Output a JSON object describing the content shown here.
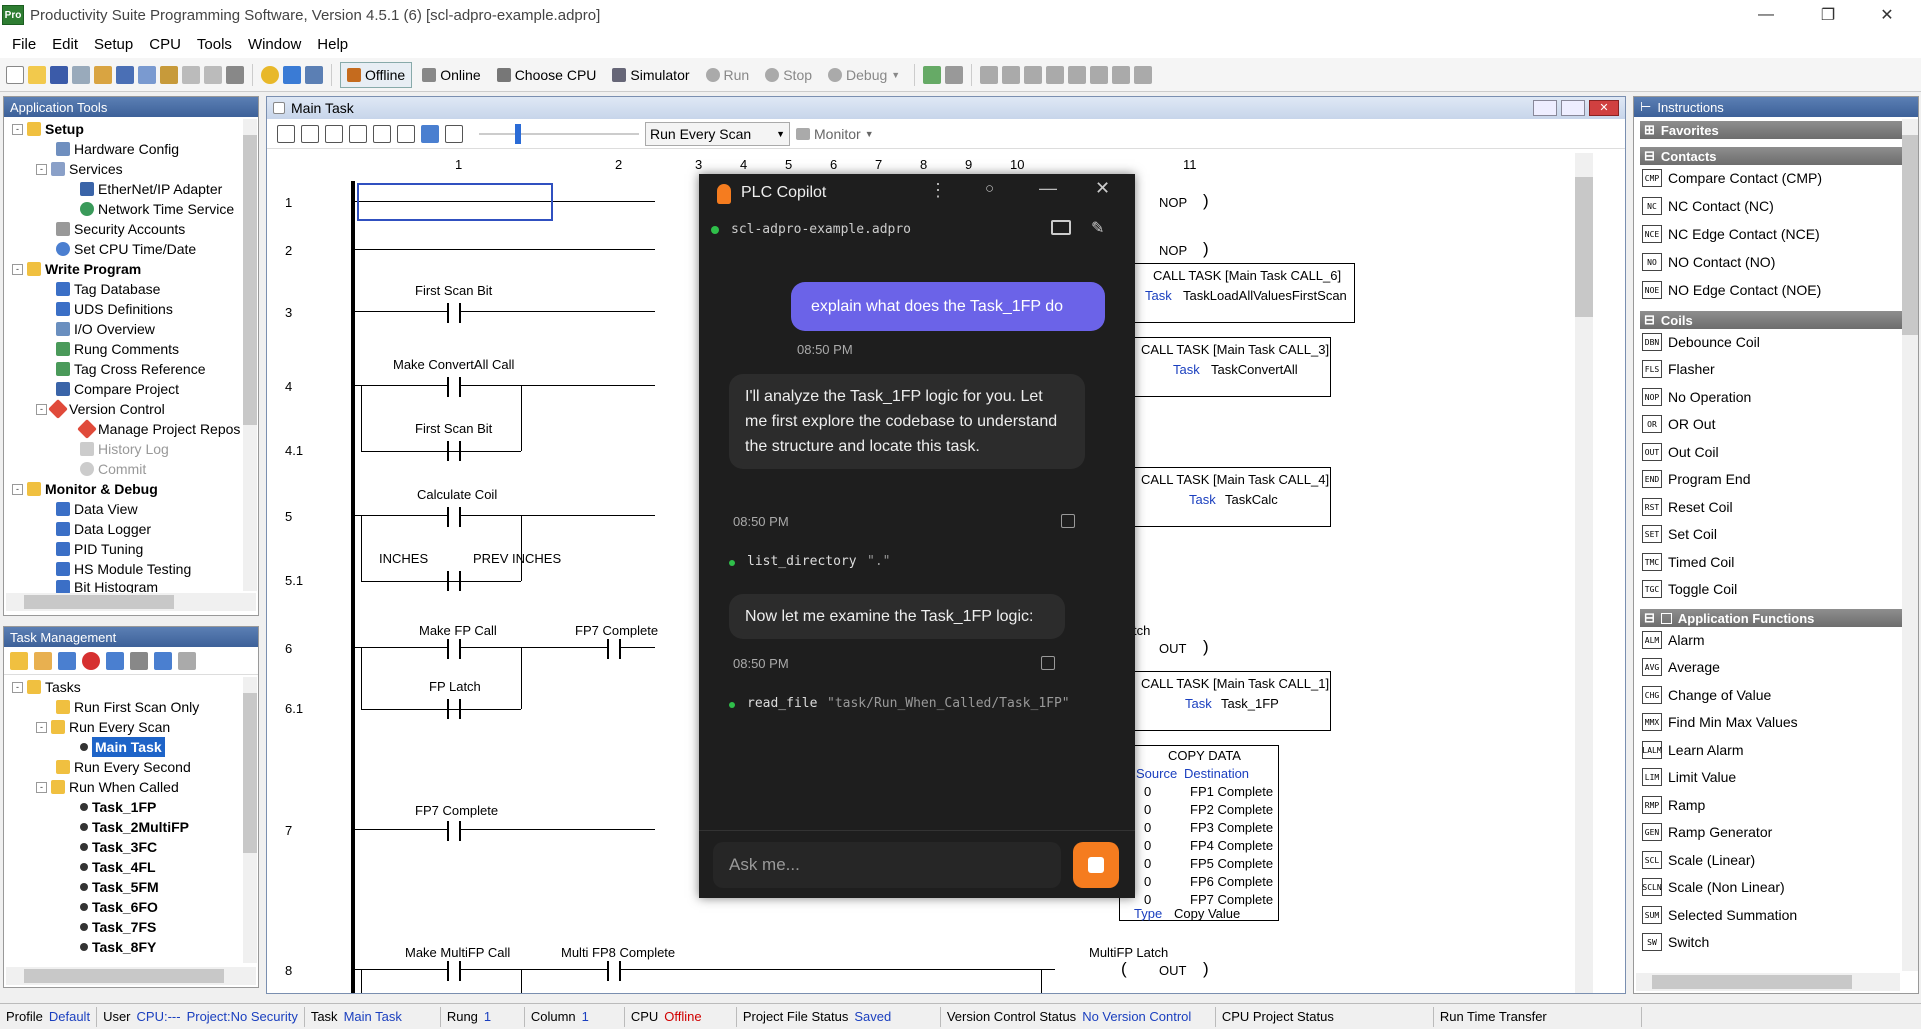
{
  "window": {
    "title": "Productivity Suite Programming Software, Version 4.5.1 (6)   [scl-adpro-example.adpro]",
    "logo": "Pro"
  },
  "menu": [
    "File",
    "Edit",
    "Setup",
    "CPU",
    "Tools",
    "Window",
    "Help"
  ],
  "toolbar": {
    "offline": "Offline",
    "online": "Online",
    "choose_cpu": "Choose CPU",
    "simulator": "Simulator",
    "run": "Run",
    "stop": "Stop",
    "debug": "Debug"
  },
  "app_tools": {
    "title": "Application Tools",
    "items": [
      {
        "label": "Setup"
      },
      {
        "label": "Hardware Config"
      },
      {
        "label": "Services"
      },
      {
        "label": "EtherNet/IP Adapter"
      },
      {
        "label": "Network Time Service"
      },
      {
        "label": "Security Accounts"
      },
      {
        "label": "Set CPU Time/Date"
      },
      {
        "label": "Write Program"
      },
      {
        "label": "Tag Database"
      },
      {
        "label": "UDS Definitions"
      },
      {
        "label": "I/O Overview"
      },
      {
        "label": "Rung Comments"
      },
      {
        "label": "Tag Cross Reference"
      },
      {
        "label": "Compare Project"
      },
      {
        "label": "Version Control"
      },
      {
        "label": "Manage Project Repos"
      },
      {
        "label": "History Log"
      },
      {
        "label": "Commit"
      },
      {
        "label": "Monitor & Debug"
      },
      {
        "label": "Data View"
      },
      {
        "label": "Data Logger"
      },
      {
        "label": "PID Tuning"
      },
      {
        "label": "HS Module Testing"
      },
      {
        "label": "Bit Histogram"
      }
    ]
  },
  "task_mgmt": {
    "title": "Task Management",
    "items": [
      {
        "label": "Tasks"
      },
      {
        "label": "Run First Scan Only"
      },
      {
        "label": "Run Every Scan"
      },
      {
        "label": "Main Task"
      },
      {
        "label": "Run Every Second"
      },
      {
        "label": "Run When Called"
      },
      {
        "label": "Task_1FP"
      },
      {
        "label": "Task_2MultiFP"
      },
      {
        "label": "Task_3FC"
      },
      {
        "label": "Task_4FL"
      },
      {
        "label": "Task_5FM"
      },
      {
        "label": "Task_6FO"
      },
      {
        "label": "Task_7FS"
      },
      {
        "label": "Task_8FY"
      }
    ]
  },
  "editor": {
    "title": "Main Task",
    "scan_select": "Run Every Scan",
    "monitor": "Monitor",
    "columns": [
      "1",
      "2",
      "3",
      "4",
      "5",
      "6",
      "7",
      "8",
      "9",
      "10",
      "11"
    ],
    "rungs": [
      "1",
      "2",
      "3",
      "4",
      "4.1",
      "5",
      "5.1",
      "6",
      "6.1",
      "7",
      "8"
    ],
    "labels": {
      "first_scan_bit": "First Scan Bit",
      "make_convertall": "Make ConvertAll Call",
      "first_scan_bit2": "First Scan Bit",
      "calculate_coil": "Calculate Coil",
      "inches": "INCHES",
      "prev_inches": "PREV INCHES",
      "make_fp_call": "Make FP Call",
      "fp7_complete": "FP7 Complete",
      "fp_latch": "FP Latch",
      "fp7_complete2": "FP7 Complete",
      "make_multifp": "Make MultiFP Call",
      "multi_fp8": "Multi FP8 Complete",
      "multifp_latch": "MultiFP Latch",
      "nop1": "NOP",
      "nop2": "NOP",
      "tch": "tch",
      "out6": "OUT",
      "out8": "OUT",
      "paren": ")",
      "lparen": "("
    },
    "calls": [
      {
        "header": "CALL TASK [Main Task CALL_6]",
        "key": "Task",
        "value": "TaskLoadAllValuesFirstScan"
      },
      {
        "header": "CALL TASK [Main Task CALL_3]",
        "key": "Task",
        "value": "TaskConvertAll"
      },
      {
        "header": "CALL TASK [Main Task CALL_4]",
        "key": "Task",
        "value": "TaskCalc"
      },
      {
        "header": "CALL TASK [Main Task CALL_1]",
        "key": "Task",
        "value": "Task_1FP"
      }
    ],
    "copy_data": {
      "header": "COPY DATA",
      "source_lbl": "Source",
      "dest_lbl": "Destination",
      "rows": [
        {
          "s": "0",
          "d": "FP1 Complete"
        },
        {
          "s": "0",
          "d": "FP2 Complete"
        },
        {
          "s": "0",
          "d": "FP3 Complete"
        },
        {
          "s": "0",
          "d": "FP4 Complete"
        },
        {
          "s": "0",
          "d": "FP5 Complete"
        },
        {
          "s": "0",
          "d": "FP6 Complete"
        },
        {
          "s": "0",
          "d": "FP7 Complete"
        }
      ],
      "type_lbl": "Type",
      "type_val": "Copy Value"
    }
  },
  "copilot": {
    "title": "PLC Copilot",
    "project": "scl-adpro-example.adpro",
    "user_msg": "explain what does the Task_1FP do",
    "user_time": "08:50 PM",
    "bot_msg1": "I'll analyze the Task_1FP logic for you. Let me first explore the codebase to understand the structure and locate this task.",
    "bot_time1": "08:50 PM",
    "tool1_name": "list_directory",
    "tool1_arg": "\".\"",
    "bot_msg2": "Now let me examine the Task_1FP logic:",
    "bot_time2": "08:50 PM",
    "tool2_name": "read_file",
    "tool2_arg": "\"task/Run_When_Called/Task_1FP\"",
    "input_placeholder": "Ask me...",
    "accent": "#f57c1f",
    "user_bubble": "#6b63e8"
  },
  "instructions": {
    "title": "Instructions",
    "sections": {
      "favorites": "Favorites",
      "contacts": "Contacts",
      "coils": "Coils",
      "app_funcs": "Application Functions"
    },
    "contacts": [
      {
        "icon": "CMP",
        "label": "Compare Contact  (CMP)"
      },
      {
        "icon": "NC",
        "label": "NC Contact  (NC)"
      },
      {
        "icon": "NCE",
        "label": "NC Edge Contact  (NCE)"
      },
      {
        "icon": "NO",
        "label": "NO Contact  (NO)"
      },
      {
        "icon": "NOE",
        "label": "NO Edge Contact  (NOE)"
      }
    ],
    "coils": [
      {
        "icon": "DBN",
        "label": "Debounce Coil"
      },
      {
        "icon": "FLS",
        "label": "Flasher"
      },
      {
        "icon": "NOP",
        "label": "No Operation"
      },
      {
        "icon": "OR",
        "label": "OR Out"
      },
      {
        "icon": "OUT",
        "label": "Out Coil"
      },
      {
        "icon": "END",
        "label": "Program End"
      },
      {
        "icon": "RST",
        "label": "Reset Coil"
      },
      {
        "icon": "SET",
        "label": "Set Coil"
      },
      {
        "icon": "TMC",
        "label": "Timed Coil"
      },
      {
        "icon": "TGC",
        "label": "Toggle Coil"
      }
    ],
    "app_funcs": [
      {
        "icon": "ALM",
        "label": "Alarm"
      },
      {
        "icon": "AVG",
        "label": "Average"
      },
      {
        "icon": "CHG",
        "label": "Change of Value"
      },
      {
        "icon": "MMX",
        "label": "Find Min Max Values"
      },
      {
        "icon": "LALM",
        "label": "Learn Alarm"
      },
      {
        "icon": "LIM",
        "label": "Limit Value"
      },
      {
        "icon": "RMP",
        "label": "Ramp"
      },
      {
        "icon": "GEN",
        "label": "Ramp Generator"
      },
      {
        "icon": "SCL",
        "label": "Scale (Linear)"
      },
      {
        "icon": "SCLN",
        "label": "Scale (Non Linear)"
      },
      {
        "icon": "SUM",
        "label": "Selected Summation"
      },
      {
        "icon": "SW",
        "label": "Switch"
      }
    ]
  },
  "status": {
    "profile_lbl": "Profile",
    "profile_val": "Default",
    "user_lbl": "User",
    "user_val": "CPU:---",
    "project_val": "Project:No Security",
    "task_lbl": "Task",
    "task_val": "Main Task",
    "rung_lbl": "Rung",
    "rung_val": "1",
    "column_lbl": "Column",
    "column_val": "1",
    "cpu_lbl": "CPU",
    "cpu_val": "Offline",
    "pfs_lbl": "Project File Status",
    "pfs_val": "Saved",
    "vcs_lbl": "Version Control Status",
    "vcs_val": "No Version Control",
    "cps_lbl": "CPU Project Status",
    "rtt_lbl": "Run Time Transfer"
  }
}
